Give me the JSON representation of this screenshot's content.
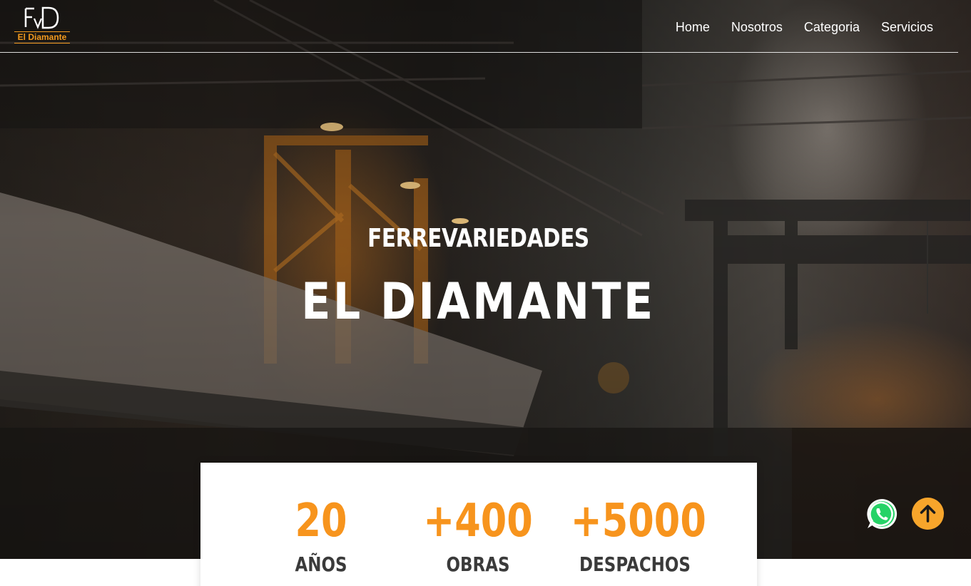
{
  "header": {
    "logo_text": "El Diamante",
    "nav": [
      "Home",
      "Nosotros",
      "Categoria",
      "Servicios"
    ]
  },
  "hero": {
    "subtitle": "FERREVARIEDADES",
    "title": "EL DIAMANTE"
  },
  "stats": [
    {
      "value": "20",
      "label": "AÑOS"
    },
    {
      "value": "+400",
      "label": "OBRAS"
    },
    {
      "value": "+5000",
      "label": "DESPACHOS"
    }
  ],
  "floating": {
    "whatsapp_icon": "whatsapp-icon",
    "scroll_top_icon": "arrow-up-icon"
  },
  "colors": {
    "accent": "#f7941d",
    "whatsapp": "#25d366",
    "scroll_top": "#f7a52b"
  }
}
